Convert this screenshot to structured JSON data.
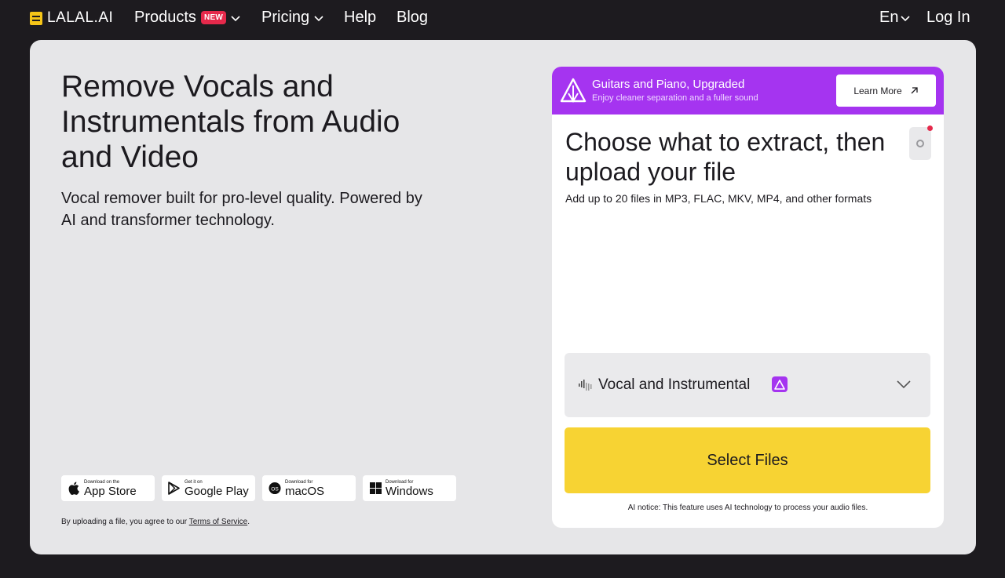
{
  "nav": {
    "logo_text": "LALAL.AI",
    "products_label": "Products",
    "products_badge": "NEW",
    "pricing_label": "Pricing",
    "help_label": "Help",
    "blog_label": "Blog",
    "language_label": "En",
    "login_label": "Log In"
  },
  "hero": {
    "title": "Remove Vocals and Instrumentals from Audio and Video",
    "subtitle": "Vocal remover built for pro-level quality. Powered by AI and transformer technology."
  },
  "stores": [
    {
      "small": "Download on the",
      "big": "App Store",
      "icon": "apple-icon"
    },
    {
      "small": "Get it on",
      "big": "Google Play",
      "icon": "google-play-icon"
    },
    {
      "small": "Download for",
      "big": "macOS",
      "icon": "macos-icon"
    },
    {
      "small": "Download for",
      "big": "Windows",
      "icon": "windows-icon"
    }
  ],
  "terms": {
    "prefix": "By uploading a file, you agree to our ",
    "link": "Terms of Service",
    "suffix": "."
  },
  "promo": {
    "title": "Guitars and Piano, Upgraded",
    "subtitle": "Enjoy cleaner separation and a fuller sound",
    "button_label": "Learn More"
  },
  "upload": {
    "title": "Choose what to extract, then upload your file",
    "subtitle": "Add up to 20 files in MP3, FLAC, MKV, MP4, and other formats",
    "stem_selected": "Vocal and Instrumental",
    "select_button": "Select Files",
    "ai_notice": "AI notice: This feature uses AI technology to process your audio files."
  },
  "colors": {
    "page_bg": "#1d1b1f",
    "card_bg": "#e6e6e8",
    "promo_purple": "#a534f0",
    "select_yellow": "#f7d333",
    "badge_red": "#e5294b"
  }
}
